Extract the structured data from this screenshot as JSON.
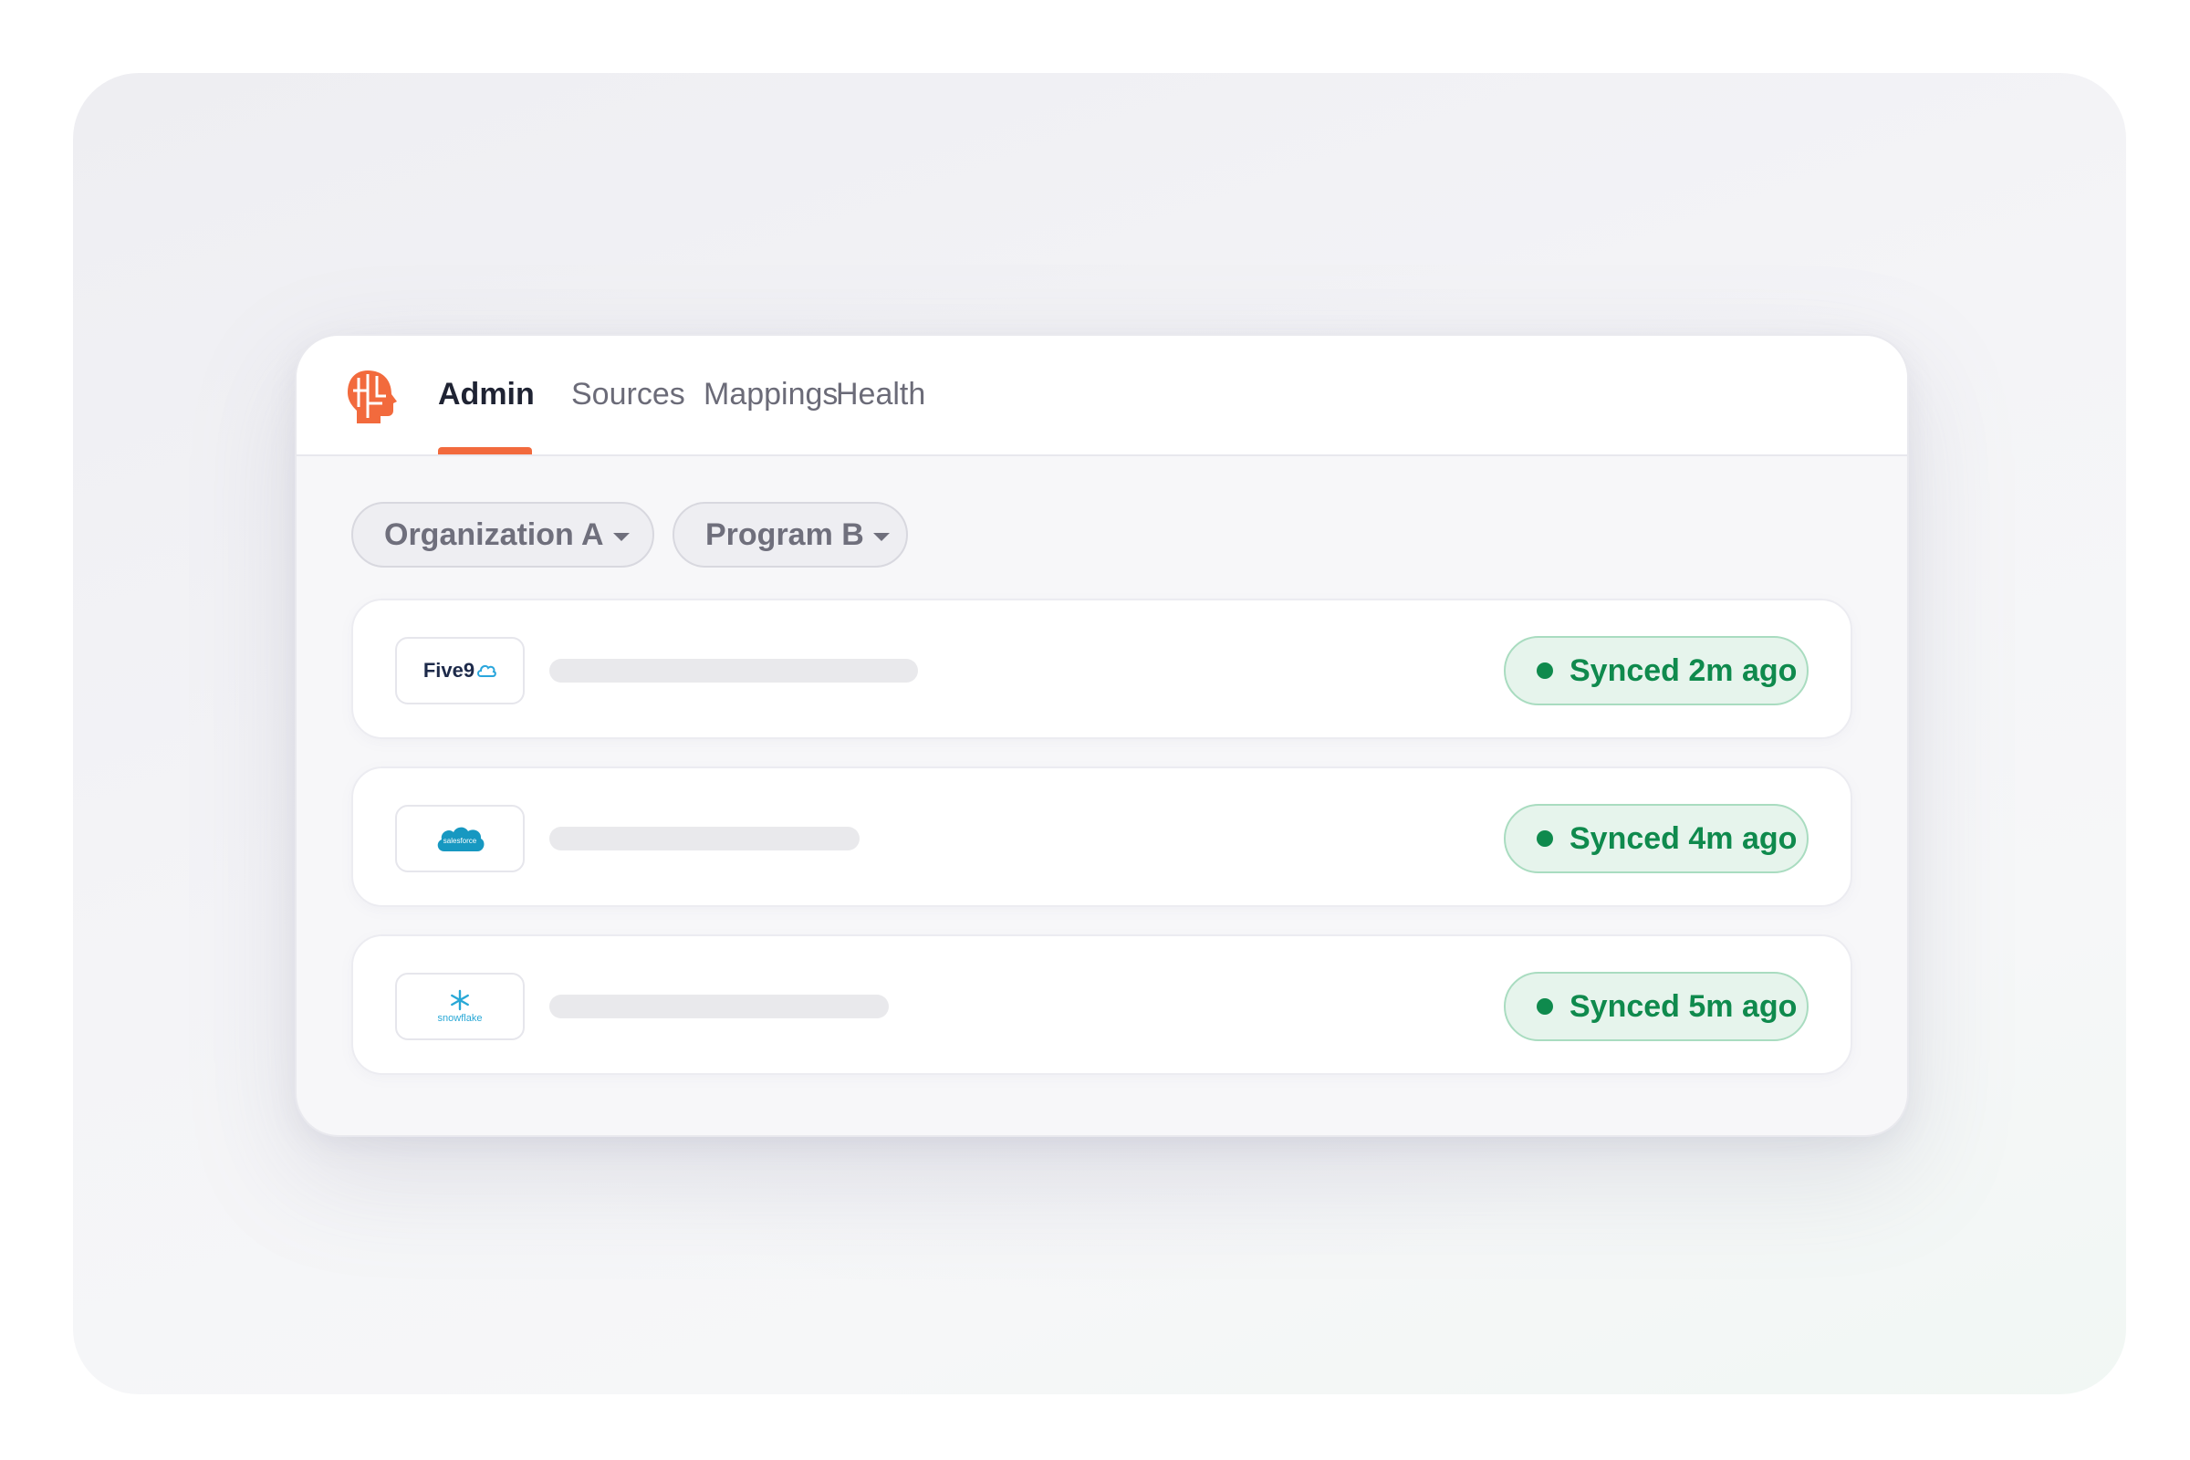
{
  "nav": {
    "tabs": [
      {
        "label": "Admin",
        "active": true
      },
      {
        "label": "Sources",
        "active": false
      },
      {
        "label": "Mappings",
        "active": false
      },
      {
        "label": "Health",
        "active": false
      }
    ],
    "logo_icon": "brain-head-icon"
  },
  "filters": [
    {
      "label": "Organization A",
      "icon": "caret-down-icon"
    },
    {
      "label": "Program B",
      "icon": "caret-down-icon"
    }
  ],
  "sources": [
    {
      "logo": "five9-logo",
      "logo_text": "Five9",
      "status": "Synced 2m ago"
    },
    {
      "logo": "salesforce-logo",
      "logo_text": "salesforce",
      "status": "Synced 4m ago"
    },
    {
      "logo": "snowflake-logo",
      "logo_text": "snowflake",
      "status": "Synced 5m ago"
    }
  ],
  "colors": {
    "accent": "#f26a3d",
    "status_green": "#0f8a4d",
    "status_bg": "#e6f4ec"
  }
}
